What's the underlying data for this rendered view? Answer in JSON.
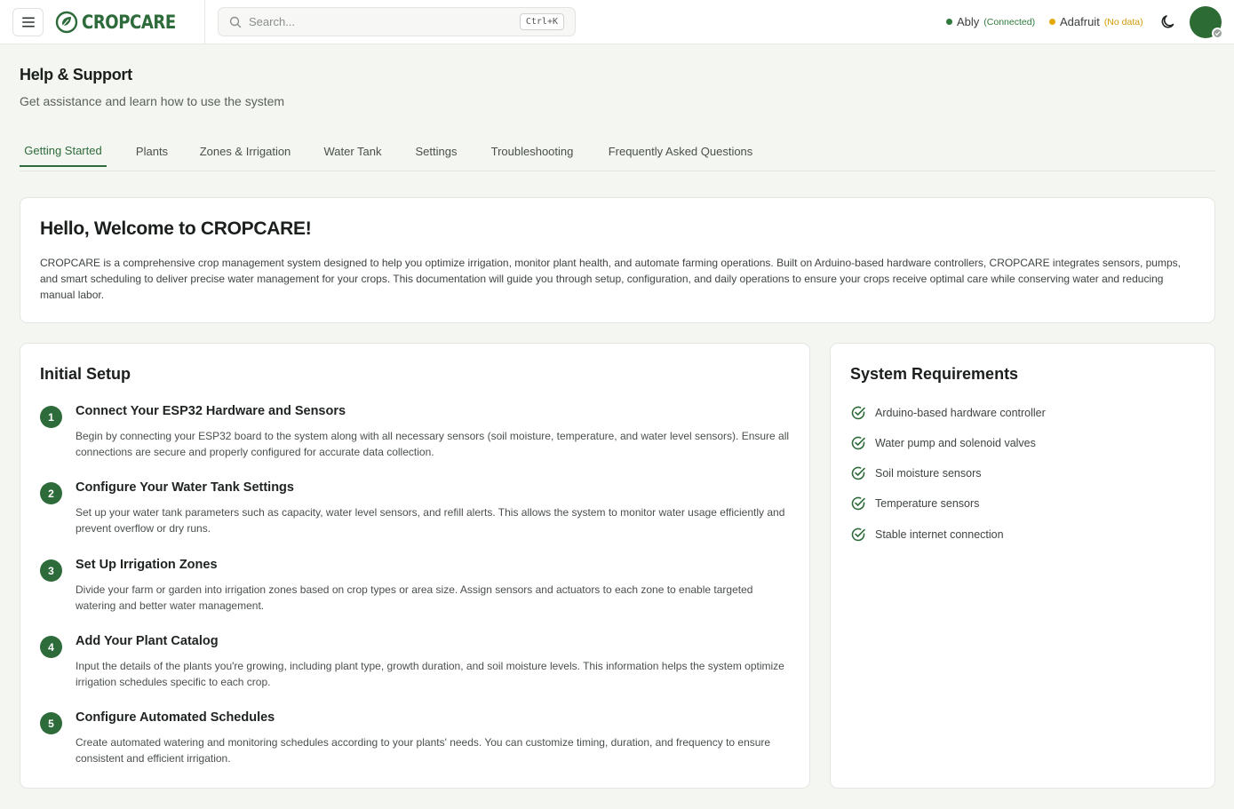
{
  "header": {
    "brand": "CROPCARE",
    "search_placeholder": "Search...",
    "search_shortcut": "Ctrl+K",
    "integrations": [
      {
        "name": "Ably",
        "status": "(Connected)",
        "color": "#2f7a3c"
      },
      {
        "name": "Adafruit",
        "status": "(No data)",
        "color": "#e3a907"
      }
    ]
  },
  "page": {
    "title": "Help & Support",
    "subtitle": "Get assistance and learn how to use the system"
  },
  "tabs": [
    {
      "label": "Getting Started",
      "active": true
    },
    {
      "label": "Plants"
    },
    {
      "label": "Zones & Irrigation"
    },
    {
      "label": "Water Tank"
    },
    {
      "label": "Settings"
    },
    {
      "label": "Troubleshooting"
    },
    {
      "label": "Frequently Asked Questions"
    }
  ],
  "welcome": {
    "title": "Hello, Welcome to CROPCARE!",
    "body": "CROPCARE is a comprehensive crop management system designed to help you optimize irrigation, monitor plant health, and automate farming operations. Built on Arduino-based hardware controllers, CROPCARE integrates sensors, pumps, and smart scheduling to deliver precise water management for your crops. This documentation will guide you through setup, configuration, and daily operations to ensure your crops receive optimal care while conserving water and reducing manual labor."
  },
  "setup": {
    "title": "Initial Setup",
    "steps": [
      {
        "num": "1",
        "title": "Connect Your ESP32 Hardware and Sensors",
        "desc": "Begin by connecting your ESP32 board to the system along with all necessary sensors (soil moisture, temperature, and water level sensors). Ensure all connections are secure and properly configured for accurate data collection."
      },
      {
        "num": "2",
        "title": "Configure Your Water Tank Settings",
        "desc": "Set up your water tank parameters such as capacity, water level sensors, and refill alerts. This allows the system to monitor water usage efficiently and prevent overflow or dry runs."
      },
      {
        "num": "3",
        "title": "Set Up Irrigation Zones",
        "desc": "Divide your farm or garden into irrigation zones based on crop types or area size. Assign sensors and actuators to each zone to enable targeted watering and better water management."
      },
      {
        "num": "4",
        "title": "Add Your Plant Catalog",
        "desc": "Input the details of the plants you're growing, including plant type, growth duration, and soil moisture levels. This information helps the system optimize irrigation schedules specific to each crop."
      },
      {
        "num": "5",
        "title": "Configure Automated Schedules",
        "desc": "Create automated watering and monitoring schedules according to your plants' needs. You can customize timing, duration, and frequency to ensure consistent and efficient irrigation."
      }
    ]
  },
  "requirements": {
    "title": "System Requirements",
    "items": [
      "Arduino-based hardware controller",
      "Water pump and solenoid valves",
      "Soil moisture sensors",
      "Temperature sensors",
      "Stable internet connection"
    ]
  }
}
